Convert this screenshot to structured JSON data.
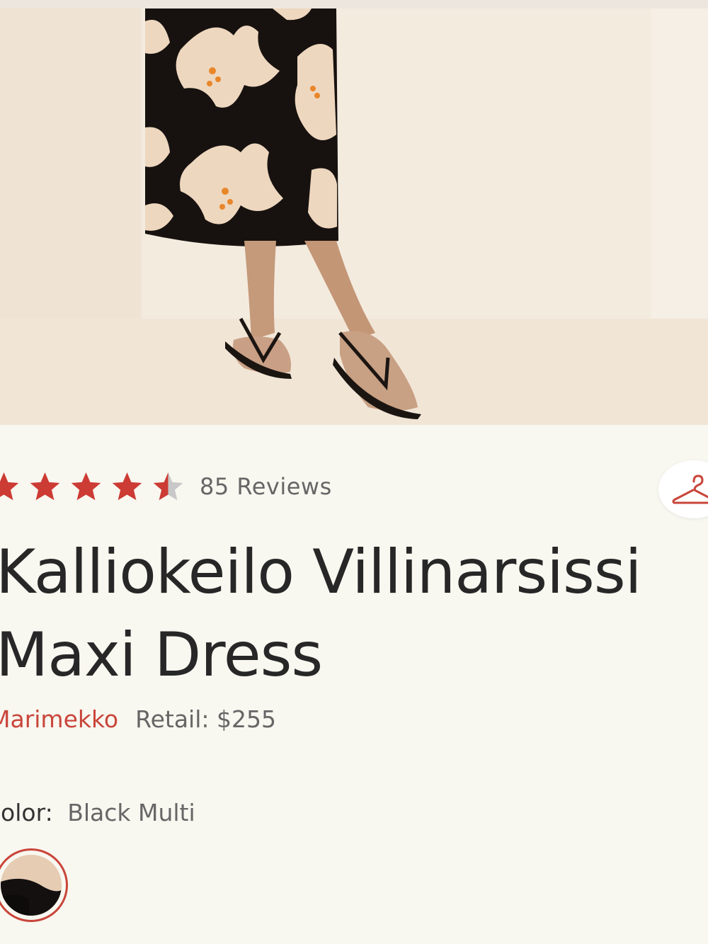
{
  "product": {
    "rating": {
      "stars": 4.5,
      "review_count_text": "85 Reviews"
    },
    "title_line1": "Kalliokeilo Villinarsissi",
    "title_line2": "Maxi Dress",
    "brand": "Marimekko",
    "retail": "Retail: $255",
    "color_label": "Color:",
    "color_value": "Black Multi"
  },
  "icons": {
    "star": "star-icon",
    "closet": "hanger-icon"
  },
  "colors": {
    "accent": "#c9453a",
    "star_filled": "#cc3b34",
    "star_empty": "#c8c8c8",
    "background": "#f8f7f0"
  }
}
